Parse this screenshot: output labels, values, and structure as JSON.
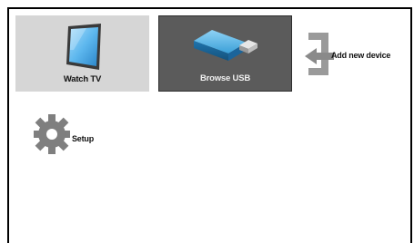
{
  "menu": {
    "tiles": [
      {
        "label": "Watch TV",
        "icon": "tv-icon",
        "selected": false
      },
      {
        "label": "Browse USB",
        "icon": "usb-drive-icon",
        "selected": true
      }
    ],
    "add_device": {
      "label": "Add new device",
      "icon": "add-device-arrow-icon"
    },
    "setup": {
      "label": "Setup",
      "icon": "gear-icon"
    }
  },
  "colors": {
    "selected_tile": "#5b5b5b",
    "tile": "#d6d6d6",
    "usb_blue": "#3aa0d8",
    "tv_blue": "#6fbff0"
  }
}
